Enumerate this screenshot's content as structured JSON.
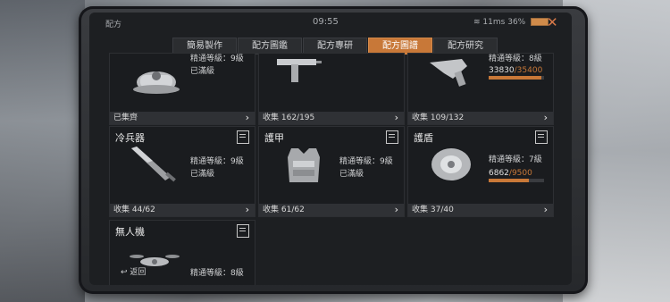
{
  "status": {
    "app_name": "配方",
    "time": "09:55",
    "network": "11ms",
    "battery": "36%"
  },
  "tabs": [
    {
      "label": "簡易製作",
      "active": false
    },
    {
      "label": "配方圖鑑",
      "active": false
    },
    {
      "label": "配方專研",
      "active": false
    },
    {
      "label": "配方圖譜",
      "active": true
    },
    {
      "label": "配方研究",
      "active": false
    }
  ],
  "cards": {
    "top1": {
      "level": "精通等級：9級",
      "state": "已滿級",
      "footer": "已集齊",
      "icon": "cap-icon"
    },
    "top2": {
      "footer": "收集 162/195",
      "icon": "smg-icon"
    },
    "top3": {
      "level": "精通等級：8級",
      "progress_cur": "33830",
      "progress_max": "/35400",
      "progress_fraction": 0.956,
      "footer": "收集 109/132",
      "icon": "rifle-icon"
    },
    "melee": {
      "title": "冷兵器",
      "level": "精通等級：9級",
      "state": "已滿級",
      "footer": "收集 44/62",
      "icon": "blade-icon"
    },
    "armor": {
      "title": "護甲",
      "level": "精通等級：9級",
      "state": "已滿級",
      "footer": "收集 61/62",
      "icon": "vest-icon"
    },
    "shield": {
      "title": "護盾",
      "level": "精通等級：7級",
      "progress_cur": "6862",
      "progress_max": "/9500",
      "progress_fraction": 0.722,
      "footer": "收集 37/40",
      "icon": "shield-armor-icon"
    },
    "drone": {
      "title": "無人機",
      "level": "精通等級：8級",
      "icon": "drone-icon"
    }
  },
  "back_label": "返回",
  "colors": {
    "accent": "#c87838",
    "close": "#d97a4a"
  }
}
